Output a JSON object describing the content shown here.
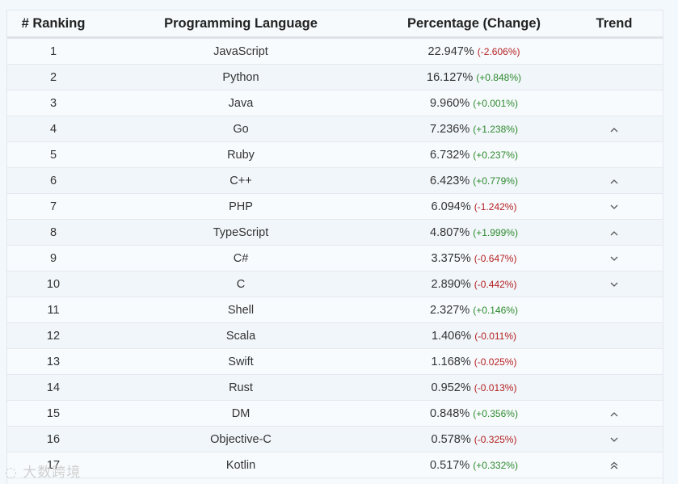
{
  "header": {
    "ranking": "# Ranking",
    "language": "Programming Language",
    "percentage": "Percentage (Change)",
    "trend": "Trend"
  },
  "rows": [
    {
      "rank": "1",
      "lang": "JavaScript",
      "pct": "22.947%",
      "chg": "(-2.606%)",
      "sign": "neg",
      "trend": "none"
    },
    {
      "rank": "2",
      "lang": "Python",
      "pct": "16.127%",
      "chg": "(+0.848%)",
      "sign": "pos",
      "trend": "none"
    },
    {
      "rank": "3",
      "lang": "Java",
      "pct": "9.960%",
      "chg": "(+0.001%)",
      "sign": "pos",
      "trend": "none"
    },
    {
      "rank": "4",
      "lang": "Go",
      "pct": "7.236%",
      "chg": "(+1.238%)",
      "sign": "pos",
      "trend": "up"
    },
    {
      "rank": "5",
      "lang": "Ruby",
      "pct": "6.732%",
      "chg": "(+0.237%)",
      "sign": "pos",
      "trend": "none"
    },
    {
      "rank": "6",
      "lang": "C++",
      "pct": "6.423%",
      "chg": "(+0.779%)",
      "sign": "pos",
      "trend": "up"
    },
    {
      "rank": "7",
      "lang": "PHP",
      "pct": "6.094%",
      "chg": "(-1.242%)",
      "sign": "neg",
      "trend": "down"
    },
    {
      "rank": "8",
      "lang": "TypeScript",
      "pct": "4.807%",
      "chg": "(+1.999%)",
      "sign": "pos",
      "trend": "up"
    },
    {
      "rank": "9",
      "lang": "C#",
      "pct": "3.375%",
      "chg": "(-0.647%)",
      "sign": "neg",
      "trend": "down"
    },
    {
      "rank": "10",
      "lang": "C",
      "pct": "2.890%",
      "chg": "(-0.442%)",
      "sign": "neg",
      "trend": "down"
    },
    {
      "rank": "11",
      "lang": "Shell",
      "pct": "2.327%",
      "chg": "(+0.146%)",
      "sign": "pos",
      "trend": "none"
    },
    {
      "rank": "12",
      "lang": "Scala",
      "pct": "1.406%",
      "chg": "(-0.011%)",
      "sign": "neg",
      "trend": "none"
    },
    {
      "rank": "13",
      "lang": "Swift",
      "pct": "1.168%",
      "chg": "(-0.025%)",
      "sign": "neg",
      "trend": "none"
    },
    {
      "rank": "14",
      "lang": "Rust",
      "pct": "0.952%",
      "chg": "(-0.013%)",
      "sign": "neg",
      "trend": "none"
    },
    {
      "rank": "15",
      "lang": "DM",
      "pct": "0.848%",
      "chg": "(+0.356%)",
      "sign": "pos",
      "trend": "up"
    },
    {
      "rank": "16",
      "lang": "Objective-C",
      "pct": "0.578%",
      "chg": "(-0.325%)",
      "sign": "neg",
      "trend": "down"
    },
    {
      "rank": "17",
      "lang": "Kotlin",
      "pct": "0.517%",
      "chg": "(+0.332%)",
      "sign": "pos",
      "trend": "double-up"
    }
  ],
  "colors": {
    "negative": "#b42020",
    "positive": "#2e8a2e"
  },
  "watermark": "大数跨境"
}
